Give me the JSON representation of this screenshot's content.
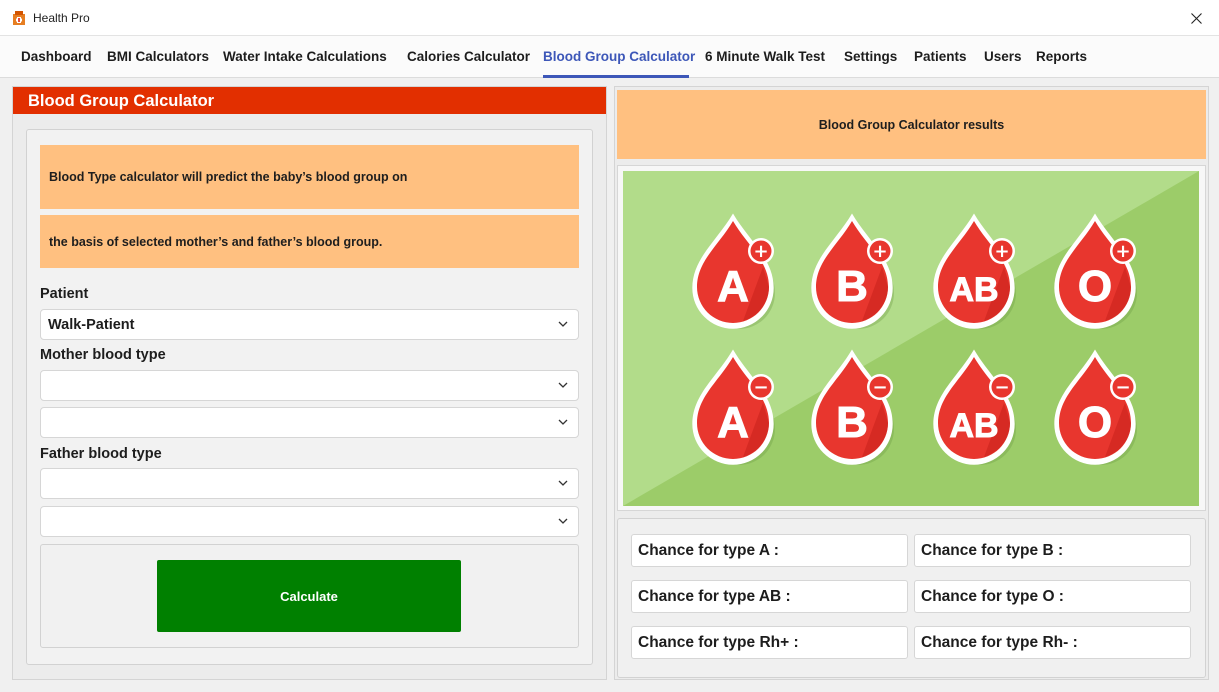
{
  "app": {
    "title": "Health Pro"
  },
  "menu": {
    "tabs": [
      {
        "label": "Dashboard"
      },
      {
        "label": "BMI Calculators"
      },
      {
        "label": "Water Intake Calculations"
      },
      {
        "label": "Calories Calculator"
      },
      {
        "label": "Blood Group Calculator",
        "active": true
      },
      {
        "label": "6 Minute Walk Test"
      },
      {
        "label": "Settings"
      },
      {
        "label": "Patients"
      },
      {
        "label": "Users"
      },
      {
        "label": "Reports"
      }
    ]
  },
  "calculator": {
    "header": "Blood Group Calculator",
    "info_line1": "Blood Type calculator will predict the baby’s blood group on",
    "info_line2": "the basis of selected mother’s and father’s blood group.",
    "patient_label": "Patient",
    "patient_value": "Walk-Patient",
    "mother_label": "Mother blood type",
    "mother_type_value": "",
    "mother_rh_value": "",
    "father_label": "Father blood type",
    "father_type_value": "",
    "father_rh_value": "",
    "calculate_label": "Calculate"
  },
  "results": {
    "header": "Blood Group Calculator results",
    "chance_a": "Chance for type A :",
    "chance_b": "Chance for type B :",
    "chance_ab": "Chance for type AB :",
    "chance_o": "Chance for type O :",
    "chance_rh_pos": "Chance for type Rh+ :",
    "chance_rh_neg": "Chance for type Rh- :"
  },
  "illustration": {
    "drops": [
      {
        "text": "A",
        "sign": "+"
      },
      {
        "text": "B",
        "sign": "+"
      },
      {
        "text": "AB",
        "sign": "+"
      },
      {
        "text": "O",
        "sign": "+"
      },
      {
        "text": "A",
        "sign": "−"
      },
      {
        "text": "B",
        "sign": "−"
      },
      {
        "text": "AB",
        "sign": "−"
      },
      {
        "text": "O",
        "sign": "−"
      }
    ]
  },
  "colors": {
    "accent": "#3d57b8",
    "header_red": "#e22f00",
    "info_orange": "#ffc080",
    "calculate_green": "#008000",
    "drop_red": "#e8362e",
    "bg_green_light": "#b2dc8a",
    "bg_green_dark": "#9ccc69"
  }
}
